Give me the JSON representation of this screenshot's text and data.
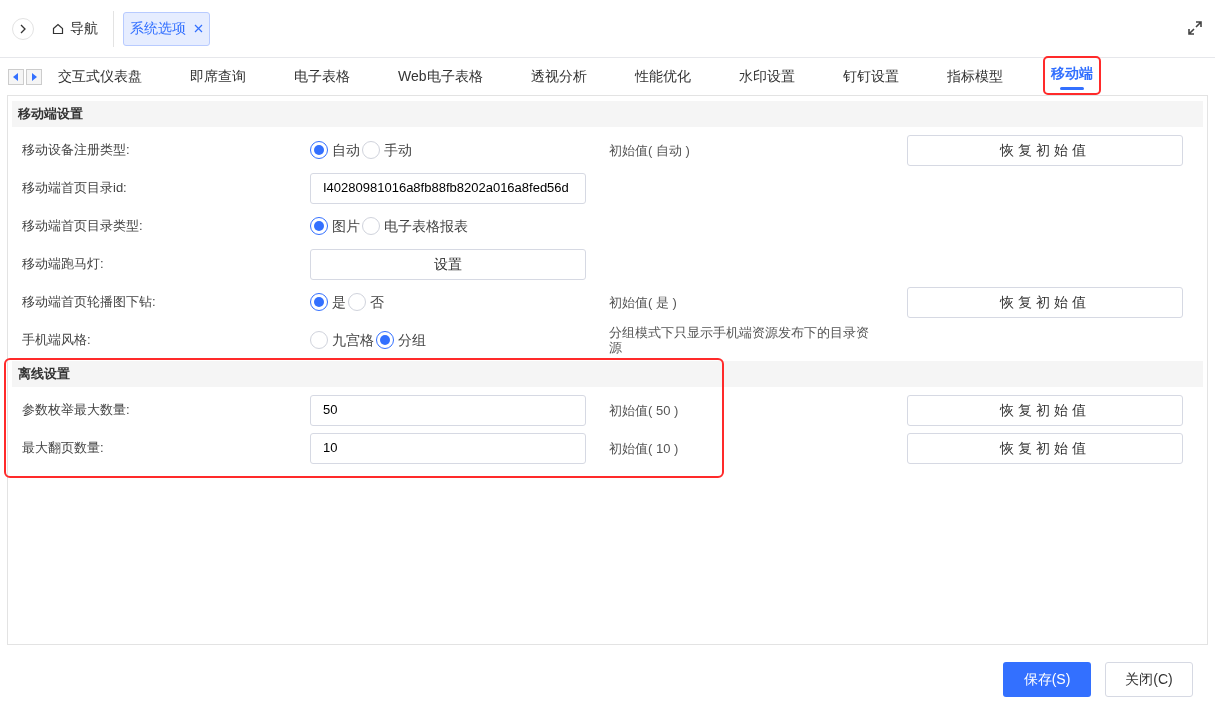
{
  "top_bar": {
    "nav_label": "导航",
    "open_tabs": [
      {
        "label": "系统选项",
        "selected": true
      }
    ]
  },
  "option_tabs": [
    {
      "label": "交互式仪表盘",
      "selected": false,
      "highlighted": false
    },
    {
      "label": "即席查询",
      "selected": false,
      "highlighted": false
    },
    {
      "label": "电子表格",
      "selected": false,
      "highlighted": false
    },
    {
      "label": "Web电子表格",
      "selected": false,
      "highlighted": false
    },
    {
      "label": "透视分析",
      "selected": false,
      "highlighted": false
    },
    {
      "label": "性能优化",
      "selected": false,
      "highlighted": false
    },
    {
      "label": "水印设置",
      "selected": false,
      "highlighted": false
    },
    {
      "label": "钉钉设置",
      "selected": false,
      "highlighted": false
    },
    {
      "label": "指标模型",
      "selected": false,
      "highlighted": false
    },
    {
      "label": "移动端",
      "selected": true,
      "highlighted": true
    }
  ],
  "sections": [
    {
      "title": "移动端设置",
      "highlighted": false,
      "rows": [
        {
          "label": "移动设备注册类型:",
          "kind": "radio",
          "options": [
            {
              "label": "自动",
              "selected": true
            },
            {
              "label": "手动",
              "selected": false
            }
          ],
          "initial": "初始值( 自动 )",
          "restore": "恢复初始值"
        },
        {
          "label": "移动端首页目录id:",
          "kind": "text",
          "value": "I40280981016a8fb88fb8202a016a8fed56d"
        },
        {
          "label": "移动端首页目录类型:",
          "kind": "radio",
          "options": [
            {
              "label": "图片",
              "selected": true
            },
            {
              "label": "电子表格报表",
              "selected": false
            }
          ]
        },
        {
          "label": "移动端跑马灯:",
          "kind": "button",
          "button": "设置"
        },
        {
          "label": "移动端首页轮播图下钻:",
          "kind": "radio",
          "options": [
            {
              "label": "是",
              "selected": true
            },
            {
              "label": "否",
              "selected": false
            }
          ],
          "initial": "初始值( 是 )",
          "restore": "恢复初始值"
        },
        {
          "label": "手机端风格:",
          "kind": "radio",
          "options": [
            {
              "label": "九宫格",
              "selected": false
            },
            {
              "label": "分组",
              "selected": true
            }
          ],
          "note": "分组模式下只显示手机端资源发布下的目录资源"
        }
      ]
    },
    {
      "title": "离线设置",
      "highlighted": true,
      "rows": [
        {
          "label": "参数枚举最大数量:",
          "kind": "text",
          "value": "50",
          "initial": "初始值( 50 )",
          "restore": "恢复初始值"
        },
        {
          "label": "最大翻页数量:",
          "kind": "text",
          "value": "10",
          "initial": "初始值( 10 )",
          "restore": "恢复初始值"
        }
      ]
    }
  ],
  "footer": [
    {
      "label": "保存(S)",
      "kind": "primary"
    },
    {
      "label": "关闭(C)",
      "kind": "default"
    }
  ]
}
